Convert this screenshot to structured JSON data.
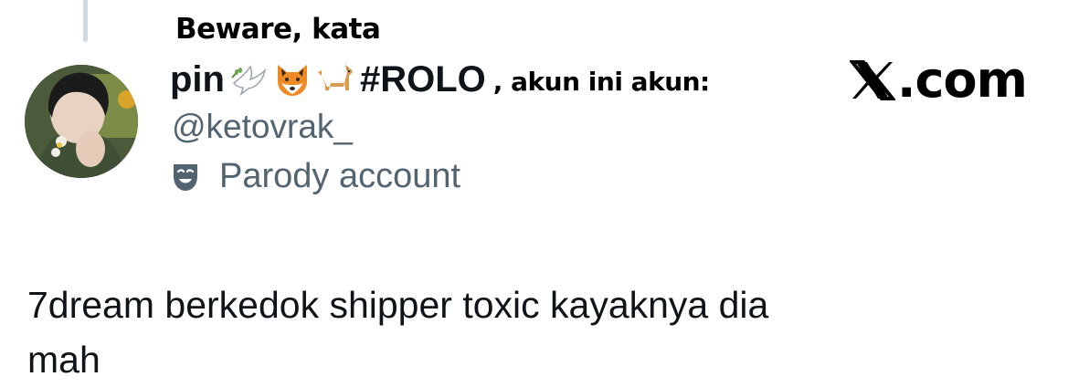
{
  "overlay": {
    "line1": "Beware, kata",
    "line2": ", akun ini akun:"
  },
  "watermark": {
    "text": ".com",
    "icon": "x-logo-icon"
  },
  "author": {
    "display_name_prefix": "pin",
    "emoji_icons": [
      "dove-icon",
      "fox-icon",
      "dog-icon"
    ],
    "display_name_suffix": "#ROLO",
    "handle": "@ketovrak_",
    "label": "Parody account",
    "label_icon": "parody-mask-icon"
  },
  "tweet": {
    "text_line1": "7dream berkedok shipper toxic kayaknya dia",
    "text_line2": "mah"
  },
  "colors": {
    "text": "#0f1419",
    "secondary": "#536471",
    "thread_line": "#cfd9de"
  }
}
